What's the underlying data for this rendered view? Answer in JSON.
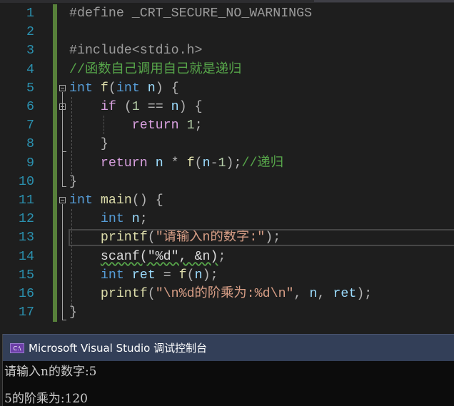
{
  "editor": {
    "lines": [
      {
        "num": "1",
        "tokens": [
          [
            "#define _CRT_SECURE_NO_WARNINGS",
            "pp"
          ]
        ]
      },
      {
        "num": "2",
        "tokens": []
      },
      {
        "num": "3",
        "tokens": [
          [
            "#include",
            "pp"
          ],
          [
            "<stdio.h>",
            "pp"
          ]
        ]
      },
      {
        "num": "4",
        "tokens": [
          [
            "//函数自己调用自己就是递归",
            "cm"
          ]
        ]
      },
      {
        "num": "5",
        "tokens": [
          [
            "int",
            "kw"
          ],
          [
            " ",
            ""
          ],
          [
            "f",
            "fn"
          ],
          [
            "(",
            "pu"
          ],
          [
            "int",
            "kw"
          ],
          [
            " ",
            ""
          ],
          [
            "n",
            "var"
          ],
          [
            ") {",
            "pu"
          ]
        ]
      },
      {
        "num": "6",
        "tokens": [
          [
            "    ",
            ""
          ],
          [
            "if",
            "ctl"
          ],
          [
            " (",
            "pu"
          ],
          [
            "1",
            "nu"
          ],
          [
            " == ",
            "pu"
          ],
          [
            "n",
            "var"
          ],
          [
            ") {",
            "pu"
          ]
        ]
      },
      {
        "num": "7",
        "tokens": [
          [
            "        ",
            ""
          ],
          [
            "return",
            "ctl"
          ],
          [
            " ",
            ""
          ],
          [
            "1",
            "nu"
          ],
          [
            ";",
            "pu"
          ]
        ]
      },
      {
        "num": "8",
        "tokens": [
          [
            "    ",
            ""
          ],
          [
            "}",
            "pu"
          ]
        ]
      },
      {
        "num": "9",
        "tokens": [
          [
            "    ",
            ""
          ],
          [
            "return",
            "ctl"
          ],
          [
            " ",
            ""
          ],
          [
            "n",
            "var"
          ],
          [
            " * ",
            "pu"
          ],
          [
            "f",
            "fn"
          ],
          [
            "(",
            "pu"
          ],
          [
            "n",
            "var"
          ],
          [
            "-",
            "pu"
          ],
          [
            "1",
            "nu"
          ],
          [
            ");",
            "pu"
          ],
          [
            "//递归",
            "cm"
          ]
        ]
      },
      {
        "num": "10",
        "tokens": [
          [
            "}",
            "pu"
          ]
        ]
      },
      {
        "num": "11",
        "tokens": [
          [
            "int",
            "kw"
          ],
          [
            " ",
            ""
          ],
          [
            "main",
            "fn"
          ],
          [
            "() {",
            "pu"
          ]
        ]
      },
      {
        "num": "12",
        "tokens": [
          [
            "    ",
            ""
          ],
          [
            "int",
            "kw"
          ],
          [
            " ",
            ""
          ],
          [
            "n",
            "var"
          ],
          [
            ";",
            "pu"
          ]
        ]
      },
      {
        "num": "13",
        "tokens": [
          [
            "    ",
            ""
          ],
          [
            "printf",
            "fn"
          ],
          [
            "(",
            "pu"
          ],
          [
            "\"请输入n的数字:\"",
            "st"
          ],
          [
            ");",
            "pu"
          ]
        ]
      },
      {
        "num": "14",
        "tokens": [
          [
            "    ",
            ""
          ],
          [
            "scanf(\"%d\", &n)",
            "squig"
          ],
          [
            ";",
            "pu"
          ]
        ]
      },
      {
        "num": "15",
        "tokens": [
          [
            "    ",
            ""
          ],
          [
            "int",
            "kw"
          ],
          [
            " ",
            ""
          ],
          [
            "ret",
            "var"
          ],
          [
            " = ",
            "pu"
          ],
          [
            "f",
            "fn"
          ],
          [
            "(",
            "pu"
          ],
          [
            "n",
            "var"
          ],
          [
            ");",
            "pu"
          ]
        ]
      },
      {
        "num": "16",
        "tokens": [
          [
            "    ",
            ""
          ],
          [
            "printf",
            "fn"
          ],
          [
            "(",
            "pu"
          ],
          [
            "\"\\n%d的阶乘为:%d\\n\"",
            "st"
          ],
          [
            ", ",
            "pu"
          ],
          [
            "n",
            "var"
          ],
          [
            ", ",
            "pu"
          ],
          [
            "ret",
            "var"
          ],
          [
            ");",
            "pu"
          ]
        ]
      },
      {
        "num": "17",
        "tokens": [
          [
            "}",
            "pu"
          ]
        ]
      }
    ]
  },
  "console": {
    "icon": "console-app-icon",
    "icon_text": "C:\\",
    "title": "Microsoft Visual Studio 调试控制台",
    "output": [
      "请输入n的数字:5",
      "5的阶乘为:120"
    ]
  },
  "colors": {
    "keyword": "#569cd6",
    "comment": "#57a64a",
    "string": "#d69d85",
    "function": "#dcdcaa",
    "control": "#d8a0df",
    "line_number": "#2b91af",
    "console_title_bg": "#333f58"
  }
}
